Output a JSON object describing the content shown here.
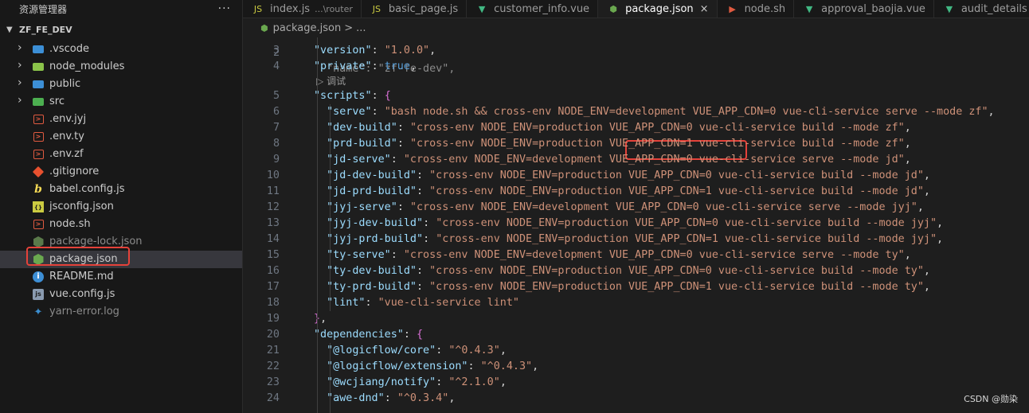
{
  "sidebar": {
    "title": "资源管理器",
    "more": "···",
    "root": "ZF_FE_DEV",
    "items": [
      {
        "label": ".vscode",
        "kind": "folder",
        "color": "#3c8fd6"
      },
      {
        "label": "node_modules",
        "kind": "folder",
        "color": "#8bc34a"
      },
      {
        "label": "public",
        "kind": "folder",
        "color": "#3c8fd6"
      },
      {
        "label": "src",
        "kind": "folder",
        "color": "#4caf50"
      },
      {
        "label": ".env.jyj",
        "kind": "env"
      },
      {
        "label": ".env.ty",
        "kind": "env"
      },
      {
        "label": ".env.zf",
        "kind": "env"
      },
      {
        "label": ".gitignore",
        "kind": "git"
      },
      {
        "label": "babel.config.js",
        "kind": "babel"
      },
      {
        "label": "jsconfig.json",
        "kind": "js"
      },
      {
        "label": "node.sh",
        "kind": "shell"
      },
      {
        "label": "package-lock.json",
        "kind": "node"
      },
      {
        "label": "package.json",
        "kind": "node"
      },
      {
        "label": "README.md",
        "kind": "info"
      },
      {
        "label": "vue.config.js",
        "kind": "vue"
      },
      {
        "label": "yarn-error.log",
        "kind": "yarn"
      }
    ]
  },
  "tabs": [
    {
      "label": "index.js",
      "path": "...\\router",
      "icon": "js-icon"
    },
    {
      "label": "basic_page.js",
      "icon": "js-icon"
    },
    {
      "label": "customer_info.vue",
      "icon": "vue-icon"
    },
    {
      "label": "package.json",
      "icon": "node-icon",
      "close": "×"
    },
    {
      "label": "node.sh",
      "icon": "terminal-icon"
    },
    {
      "label": "approval_baojia.vue",
      "icon": "vue-icon"
    },
    {
      "label": "audit_details",
      "icon": "vue-icon"
    }
  ],
  "breadcrumb": {
    "file": "package.json",
    "sep": ">",
    "rest": "..."
  },
  "editor": {
    "codelens": "调试",
    "partial_line": "  \"name\": \"zf-fe-dev\","
  },
  "code": {
    "lines": [
      {
        "n": "3",
        "key": "version",
        "val": "1.0.0"
      },
      {
        "n": "4",
        "key": "private",
        "val": "true"
      },
      {
        "n": "5",
        "key": "scripts"
      },
      {
        "n": "6",
        "key": "serve",
        "val": "bash node.sh && cross-env NODE_ENV=development VUE_APP_CDN=0 vue-cli-service serve --mode zf"
      },
      {
        "n": "7",
        "key": "dev-build",
        "val": "cross-env NODE_ENV=production VUE_APP_CDN=0 vue-cli-service build --mode zf"
      },
      {
        "n": "8",
        "key": "prd-build",
        "val": "cross-env NODE_ENV=production VUE_APP_CDN=1 vue-cli-service build --mode zf"
      },
      {
        "n": "9",
        "key": "jd-serve",
        "val": "cross-env NODE_ENV=development VUE_APP_CDN=0 vue-cli-service serve --mode jd"
      },
      {
        "n": "10",
        "key": "jd-dev-build",
        "val": "cross-env NODE_ENV=production VUE_APP_CDN=0 vue-cli-service build --mode jd"
      },
      {
        "n": "11",
        "key": "jd-prd-build",
        "val": "cross-env NODE_ENV=production VUE_APP_CDN=1 vue-cli-service build --mode jd"
      },
      {
        "n": "12",
        "key": "jyj-serve",
        "val": "cross-env NODE_ENV=development VUE_APP_CDN=0 vue-cli-service serve --mode jyj"
      },
      {
        "n": "13",
        "key": "jyj-dev-build",
        "val": "cross-env NODE_ENV=production VUE_APP_CDN=0 vue-cli-service build --mode jyj"
      },
      {
        "n": "14",
        "key": "jyj-prd-build",
        "val": "cross-env NODE_ENV=production VUE_APP_CDN=1 vue-cli-service build --mode jyj"
      },
      {
        "n": "15",
        "key": "ty-serve",
        "val": "cross-env NODE_ENV=development VUE_APP_CDN=0 vue-cli-service serve --mode ty"
      },
      {
        "n": "16",
        "key": "ty-dev-build",
        "val": "cross-env NODE_ENV=production VUE_APP_CDN=0 vue-cli-service build --mode ty"
      },
      {
        "n": "17",
        "key": "ty-prd-build",
        "val": "cross-env NODE_ENV=production VUE_APP_CDN=1 vue-cli-service build --mode ty"
      },
      {
        "n": "18",
        "key": "lint",
        "val": "vue-cli-service lint"
      },
      {
        "n": "19",
        "close": "},"
      },
      {
        "n": "20",
        "key": "dependencies"
      },
      {
        "n": "21",
        "key": "@logicflow/core",
        "val": "^0.4.3"
      },
      {
        "n": "22",
        "key": "@logicflow/extension",
        "val": "^0.4.3"
      },
      {
        "n": "23",
        "key": "@wcjiang/notify",
        "val": "^2.1.0"
      },
      {
        "n": "24",
        "key": "awe-dnd",
        "val": "^0.3.4"
      }
    ]
  },
  "watermark": "CSDN @勋染"
}
